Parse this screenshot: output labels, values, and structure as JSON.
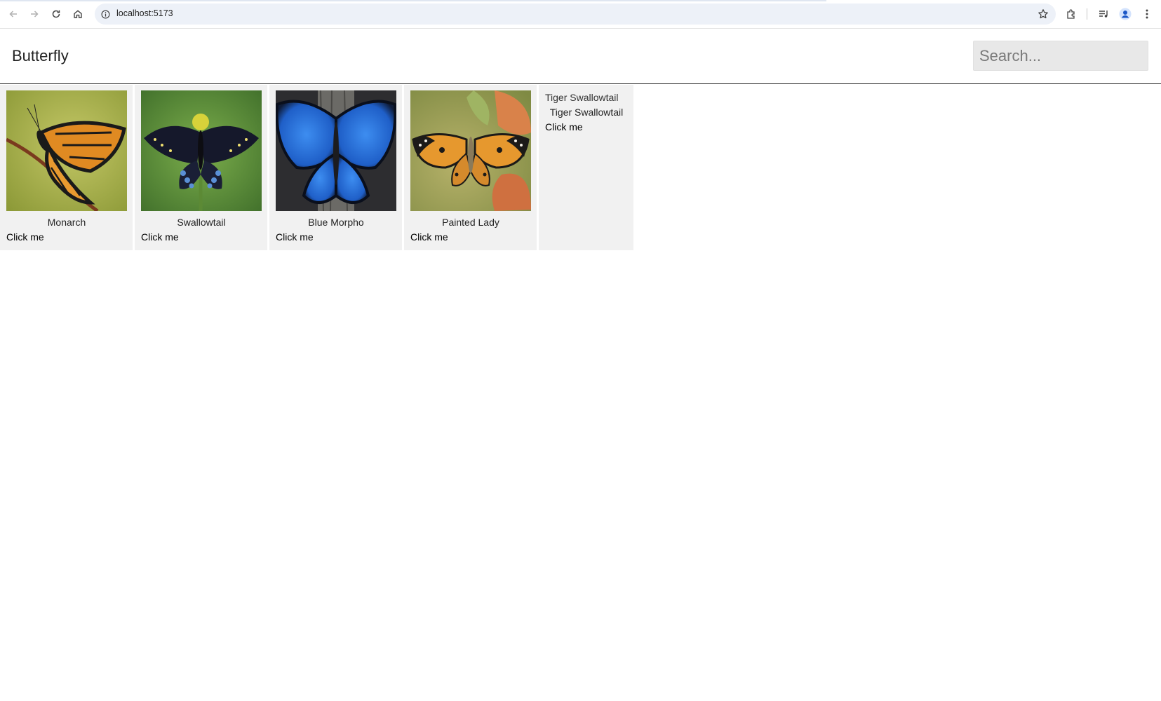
{
  "browser": {
    "url": "localhost:5173"
  },
  "header": {
    "title": "Butterfly",
    "search_placeholder": "Search..."
  },
  "cards": [
    {
      "name": "Monarch",
      "button": "Click me",
      "image_loaded": true
    },
    {
      "name": "Swallowtail",
      "button": "Click me",
      "image_loaded": true
    },
    {
      "name": "Blue Morpho",
      "button": "Click me",
      "image_loaded": true
    },
    {
      "name": "Painted Lady",
      "button": "Click me",
      "image_loaded": true
    },
    {
      "name": "Tiger Swallowtail",
      "button": "Click me",
      "image_loaded": false,
      "alt": "Tiger Swallowtail"
    }
  ],
  "colors": {
    "card_background": "#f1f1f1",
    "header_border": "#2b2b2b",
    "search_background": "#e8e8e8",
    "omnibox_background": "#edf1f8"
  }
}
